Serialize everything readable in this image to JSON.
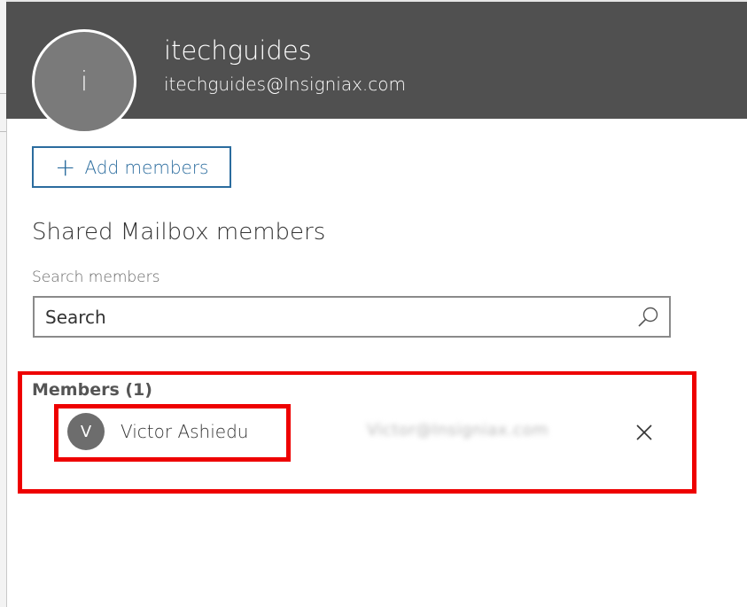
{
  "group": {
    "avatar_initial": "i",
    "name": "itechguides",
    "email": "itechguides@Insigniax.com"
  },
  "actions": {
    "add_members_label": "Add members"
  },
  "section_title": "Shared Mailbox members",
  "search": {
    "label": "Search members",
    "placeholder": "Search"
  },
  "members": {
    "heading": "Members (1)",
    "items": [
      {
        "initial": "V",
        "name": "Victor Ashiedu",
        "email": "Victor@Insigniax.com"
      }
    ]
  },
  "icons": {
    "search": "search-icon",
    "remove": "close-icon",
    "add": "plus-icon"
  },
  "colors": {
    "header_bg": "#505050",
    "accent": "#2b6c9e",
    "highlight": "#ee0000"
  }
}
